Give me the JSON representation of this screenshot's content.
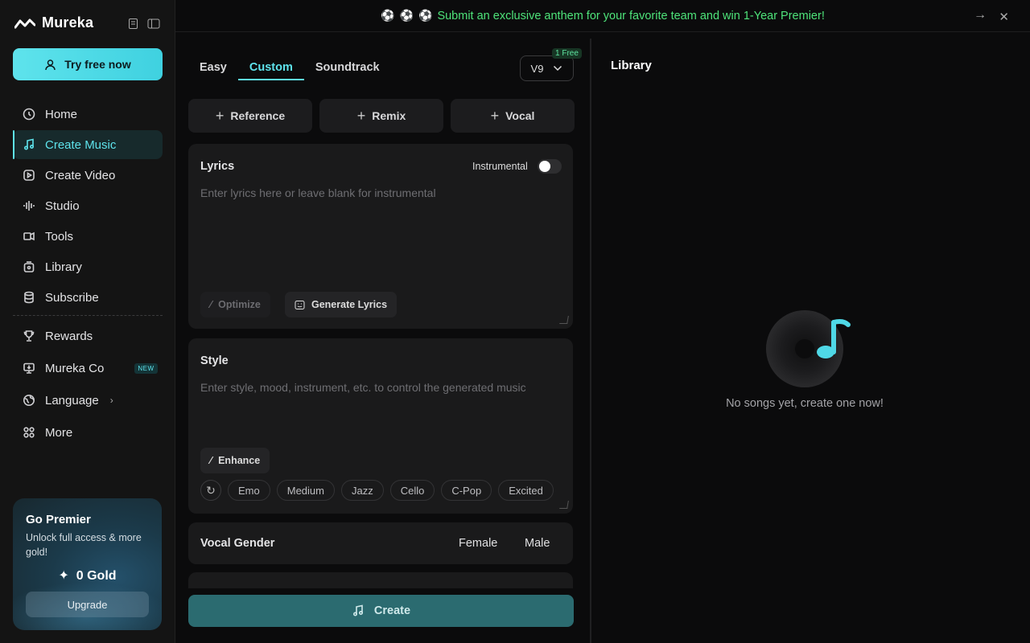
{
  "sidebar": {
    "brand": "Mureka",
    "try_button": "Try free now",
    "nav": [
      {
        "label": "Home",
        "icon": "home-icon"
      },
      {
        "label": "Create Music",
        "icon": "music-note-icon"
      },
      {
        "label": "Create Video",
        "icon": "video-icon"
      },
      {
        "label": "Studio",
        "icon": "waveform-icon"
      },
      {
        "label": "Tools",
        "icon": "tools-icon"
      },
      {
        "label": "Library",
        "icon": "library-icon"
      },
      {
        "label": "Subscribe",
        "icon": "database-icon"
      }
    ],
    "nav2": [
      {
        "label": "Rewards",
        "icon": "trophy-icon"
      },
      {
        "label": "Mureka Co",
        "icon": "monitor-icon",
        "badge": "NEW"
      },
      {
        "label": "Language",
        "icon": "globe-icon"
      },
      {
        "label": "More",
        "icon": "grid-icon"
      }
    ],
    "premier": {
      "title": "Go Premier",
      "desc": "Unlock full access & more gold!",
      "gold": "0 Gold",
      "upgrade": "Upgrade"
    }
  },
  "banner": {
    "text": "Submit an exclusive anthem for your favorite team and win 1-Year Premier!"
  },
  "create": {
    "tabs": [
      "Easy",
      "Custom",
      "Soundtrack"
    ],
    "version": "V9",
    "version_badge": "1 Free",
    "add_buttons": [
      "Reference",
      "Remix",
      "Vocal"
    ],
    "lyrics": {
      "title": "Lyrics",
      "instrumental_label": "Instrumental",
      "placeholder": "Enter lyrics here or leave blank for instrumental",
      "optimize": "Optimize",
      "generate": "Generate Lyrics"
    },
    "style": {
      "title": "Style",
      "placeholder": "Enter style, mood, instrument, etc. to control the generated music",
      "enhance": "Enhance",
      "tags": [
        "Emo",
        "Medium",
        "Jazz",
        "Cello",
        "C-Pop",
        "Excited"
      ]
    },
    "vocal_gender": {
      "title": "Vocal Gender",
      "options": [
        "Female",
        "Male"
      ]
    },
    "create_button": "Create"
  },
  "library": {
    "title": "Library",
    "empty_text": "No songs yet, create one now!"
  },
  "colors": {
    "accent": "#5ee3ec",
    "banner_green": "#4ee37a",
    "create_button": "#2b6b70"
  }
}
